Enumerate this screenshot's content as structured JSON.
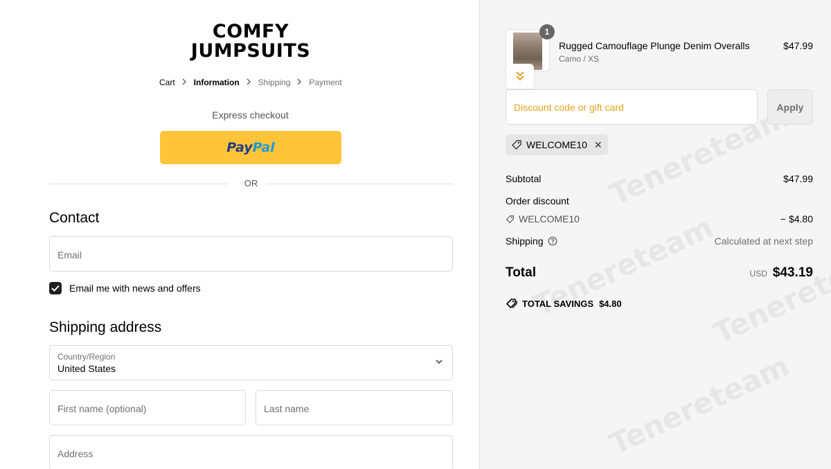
{
  "brand": {
    "line1": "COMFY",
    "line2": "JUMPSUITS"
  },
  "breadcrumb": [
    {
      "label": "Cart"
    },
    {
      "label": "Information"
    },
    {
      "label": "Shipping"
    },
    {
      "label": "Payment"
    }
  ],
  "express": {
    "title": "Express checkout",
    "paypal_pay": "Pay",
    "paypal_pal": "Pal",
    "or": "OR"
  },
  "contact": {
    "heading": "Contact",
    "email_placeholder": "Email",
    "newsletter_label": "Email me with news and offers",
    "newsletter_checked": true
  },
  "shipping": {
    "heading": "Shipping address",
    "country_label": "Country/Region",
    "country_value": "United States",
    "first_name_placeholder": "First name (optional)",
    "last_name_placeholder": "Last name",
    "address_placeholder": "Address"
  },
  "order": {
    "product": {
      "name": "Rugged Camouflage Plunge Denim Overalls",
      "variant": "Camo / XS",
      "price": "$47.99",
      "quantity": "1"
    },
    "discount_placeholder": "Discount code or gift card",
    "apply_label": "Apply",
    "applied_code": "WELCOME10",
    "subtotal_label": "Subtotal",
    "subtotal_value": "$47.99",
    "order_discount_label": "Order discount",
    "discount_code": "WELCOME10",
    "discount_value": "− $4.80",
    "shipping_label": "Shipping",
    "shipping_value": "Calculated at next step",
    "total_label": "Total",
    "currency": "USD",
    "total_value": "$43.19",
    "savings_label": "TOTAL SAVINGS",
    "savings_value": "$4.80"
  },
  "watermark": "Tenereteam",
  "colors": {
    "paypal_yellow": "#ffc439",
    "discount_placeholder": "#e8a21a",
    "sidebar_bg": "#f5f5f5"
  }
}
